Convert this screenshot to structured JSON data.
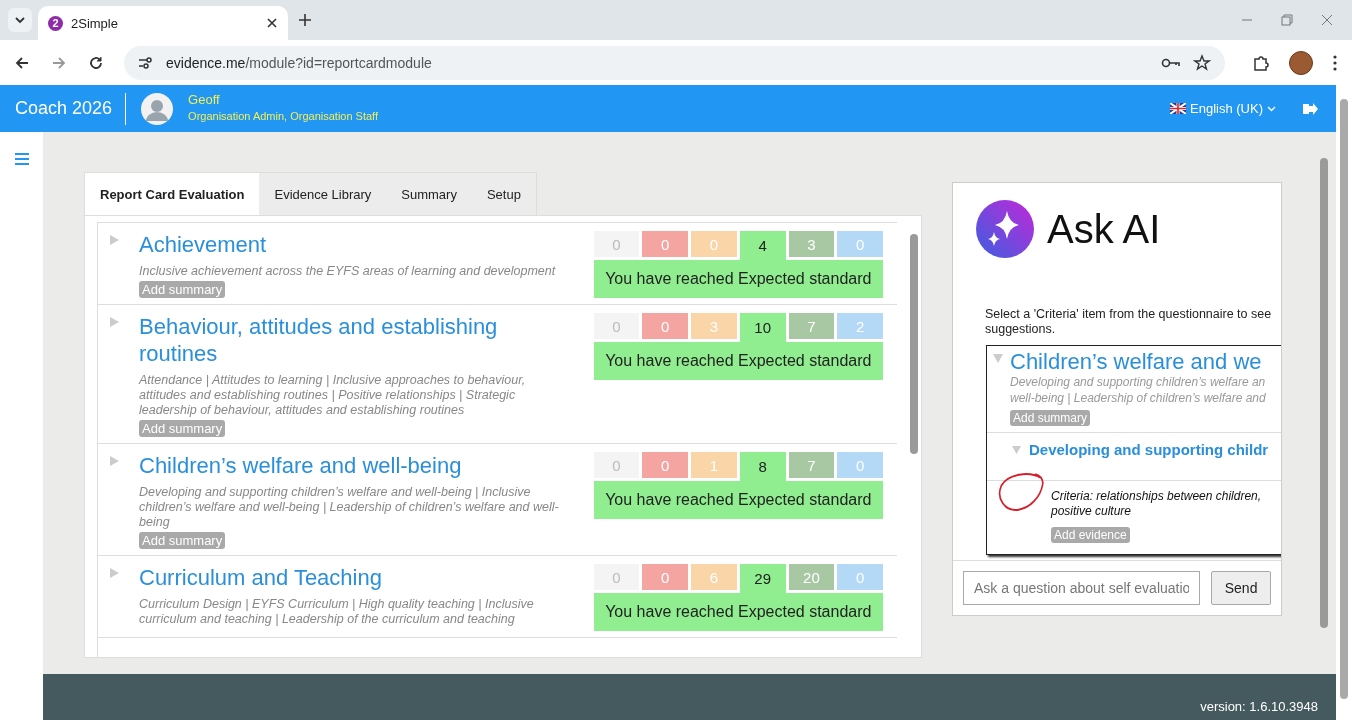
{
  "browser": {
    "tab_title": "2Simple",
    "tab_badge": "2",
    "url_host": "evidence.me",
    "url_path": "/module?id=reportcardmodule"
  },
  "header": {
    "app_title": "Coach 2026",
    "user_name": "Geoff",
    "user_roles": "Organisation Admin, Organisation Staff",
    "language": "English (UK)"
  },
  "tabs": [
    {
      "label": "Report Card Evaluation",
      "selected": true
    },
    {
      "label": "Evidence Library",
      "selected": false
    },
    {
      "label": "Summary",
      "selected": false
    },
    {
      "label": "Setup",
      "selected": false
    }
  ],
  "sections": [
    {
      "title": "Achievement",
      "description": "Inclusive achievement across the EYFS areas of learning and development",
      "button": "Add summary",
      "status": "You have reached Expected standard",
      "scores": [
        {
          "value": "0",
          "color": "#f4f4f4",
          "selected": false
        },
        {
          "value": "0",
          "color": "#f4a5a2",
          "selected": false
        },
        {
          "value": "0",
          "color": "#f9d5a8",
          "selected": false
        },
        {
          "value": "4",
          "color": "#90ee90",
          "selected": true
        },
        {
          "value": "3",
          "color": "#a8c8a4",
          "selected": false
        },
        {
          "value": "0",
          "color": "#b3d9f7",
          "selected": false
        }
      ]
    },
    {
      "title": "Behaviour, attitudes and establishing routines",
      "description": "Attendance | Attitudes to learning | Inclusive approaches to behaviour, attitudes and establishing routines | Positive relationships | Strategic leadership of behaviour, attitudes and establishing routines",
      "button": "Add summary",
      "status": "You have reached Expected standard",
      "scores": [
        {
          "value": "0",
          "color": "#f4f4f4",
          "selected": false
        },
        {
          "value": "0",
          "color": "#f4a5a2",
          "selected": false
        },
        {
          "value": "3",
          "color": "#f9d5a8",
          "selected": false
        },
        {
          "value": "10",
          "color": "#90ee90",
          "selected": true
        },
        {
          "value": "7",
          "color": "#a8c8a4",
          "selected": false
        },
        {
          "value": "2",
          "color": "#b3d9f7",
          "selected": false
        }
      ]
    },
    {
      "title": "Children’s welfare and well-being",
      "description": "Developing and supporting children’s welfare and well-being | Inclusive children’s welfare and well-being | Leadership of children’s welfare and well-being",
      "button": "Add summary",
      "status": "You have reached Expected standard",
      "scores": [
        {
          "value": "0",
          "color": "#f4f4f4",
          "selected": false
        },
        {
          "value": "0",
          "color": "#f4a5a2",
          "selected": false
        },
        {
          "value": "1",
          "color": "#f9d5a8",
          "selected": false
        },
        {
          "value": "8",
          "color": "#90ee90",
          "selected": true
        },
        {
          "value": "7",
          "color": "#a8c8a4",
          "selected": false
        },
        {
          "value": "0",
          "color": "#b3d9f7",
          "selected": false
        }
      ]
    },
    {
      "title": "Curriculum and Teaching",
      "description": "Curriculum Design | EYFS Curriculum | High quality teaching | Inclusive curriculum and teaching | Leadership of the curriculum and teaching",
      "status": "You have reached Expected standard",
      "scores": [
        {
          "value": "0",
          "color": "#f4f4f4",
          "selected": false
        },
        {
          "value": "0",
          "color": "#f4a5a2",
          "selected": false
        },
        {
          "value": "6",
          "color": "#f9d5a8",
          "selected": false
        },
        {
          "value": "29",
          "color": "#90ee90",
          "selected": true
        },
        {
          "value": "20",
          "color": "#a8c8a4",
          "selected": false
        },
        {
          "value": "0",
          "color": "#b3d9f7",
          "selected": false
        }
      ]
    }
  ],
  "ask_ai": {
    "title": "Ask AI",
    "instruction": "Select a 'Criteria' item from the questionnaire to see suggestions.",
    "preview": {
      "title": "Children’s welfare and we",
      "description_lines": [
        "Developing and supporting children’s welfare an",
        "well-being | Leadership of children’s welfare and"
      ],
      "button": "Add summary",
      "subtitle": "Developing and supporting childr",
      "criteria_lines": [
        "Criteria: relationships between children,",
        "positive culture"
      ],
      "evidence_button": "Add evidence"
    },
    "input_placeholder": "Ask a question about self evaluatio",
    "send": "Send"
  },
  "footer": {
    "version": "version: 1.6.10.3948"
  }
}
